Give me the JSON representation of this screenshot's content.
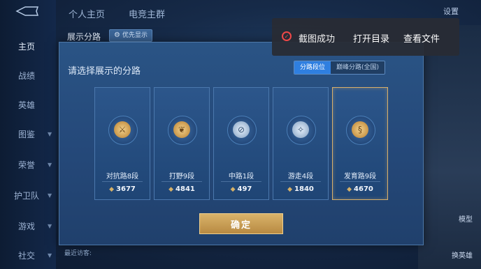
{
  "sidebar": {
    "items": [
      {
        "label": "主页"
      },
      {
        "label": "战绩"
      },
      {
        "label": "英雄"
      },
      {
        "label": "图鉴"
      },
      {
        "label": "荣誉"
      },
      {
        "label": "护卫队"
      },
      {
        "label": "游戏"
      },
      {
        "label": "社交"
      }
    ]
  },
  "topbar": {
    "tabs": [
      {
        "label": "个人主页"
      },
      {
        "label": "电竞主群"
      }
    ],
    "settings_label": "设置"
  },
  "panel": {
    "title": "展示分路",
    "priority_label": "优先显示",
    "prompt": "请选择展示的分路",
    "toggle": {
      "option_a": "分路段位",
      "option_b": "巅峰分路(全国)"
    },
    "cards": [
      {
        "lane": "对抗路8段",
        "score": "3677"
      },
      {
        "lane": "打野9段",
        "score": "4841"
      },
      {
        "lane": "中路1段",
        "score": "497"
      },
      {
        "lane": "游走4段",
        "score": "1840"
      },
      {
        "lane": "发育路9段",
        "score": "4670"
      }
    ],
    "confirm_label": "确定"
  },
  "toast": {
    "message": "截图成功",
    "open_dir": "打开目录",
    "view_file": "查看文件"
  },
  "right": {
    "btn1": "模型",
    "btn2": "换英雄"
  },
  "bottom": {
    "recent": "最近访客:"
  },
  "colors": {
    "accent": "#d9b06a",
    "toast_check": "#f04848",
    "toggle_active": "#2f7fe0"
  }
}
